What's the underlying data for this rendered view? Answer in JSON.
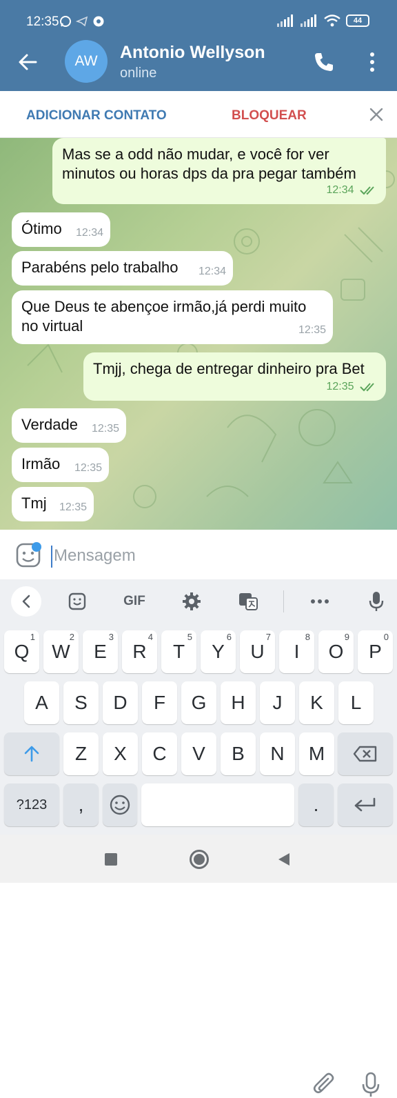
{
  "status_bar": {
    "time": "12:35",
    "battery": "44"
  },
  "header": {
    "avatar_initials": "AW",
    "contact_name": "Antonio Wellyson",
    "status": "online"
  },
  "action_bar": {
    "add_contact": "ADICIONAR CONTATO",
    "block": "BLOQUEAR"
  },
  "messages": [
    {
      "direction": "out",
      "text_line1": "Mas se a odd não mudar, e você for ver",
      "text_line2": "minutos ou horas dps da pra pegar também",
      "time": "12:34"
    },
    {
      "direction": "in",
      "text": "Ótimo",
      "time": "12:34"
    },
    {
      "direction": "in",
      "text": "Parabéns pelo trabalho",
      "time": "12:34"
    },
    {
      "direction": "in",
      "text_line1": "Que Deus te abençoe irmão,já perdi muito",
      "text_line2": "no virtual",
      "time": "12:35"
    },
    {
      "direction": "out",
      "text": "Tmjj, chega de entregar dinheiro pra Bet",
      "time": "12:35"
    },
    {
      "direction": "in",
      "text": "Verdade",
      "time": "12:35"
    },
    {
      "direction": "in",
      "text": "Irmão",
      "time": "12:35"
    },
    {
      "direction": "in",
      "text": "Tmj",
      "time": "12:35"
    }
  ],
  "input": {
    "placeholder": "Mensagem"
  },
  "keyboard": {
    "toolbar": {
      "gif": "GIF"
    },
    "row1": [
      {
        "key": "Q",
        "num": "1"
      },
      {
        "key": "W",
        "num": "2"
      },
      {
        "key": "E",
        "num": "3"
      },
      {
        "key": "R",
        "num": "4"
      },
      {
        "key": "T",
        "num": "5"
      },
      {
        "key": "Y",
        "num": "6"
      },
      {
        "key": "U",
        "num": "7"
      },
      {
        "key": "I",
        "num": "8"
      },
      {
        "key": "O",
        "num": "9"
      },
      {
        "key": "P",
        "num": "0"
      }
    ],
    "row2": [
      "A",
      "S",
      "D",
      "F",
      "G",
      "H",
      "J",
      "K",
      "L"
    ],
    "row3": [
      "Z",
      "X",
      "C",
      "V",
      "B",
      "N",
      "M"
    ],
    "row4": {
      "symbols": "?123",
      "comma": ",",
      "period": "."
    }
  },
  "colors": {
    "header": "#4a7aa5",
    "outgoing_bubble": "#eefcdc",
    "incoming_bubble": "#ffffff",
    "block_red": "#d24f4f",
    "link_blue": "#3f7ab2"
  },
  "icons": [
    "back-arrow-icon",
    "phone-icon",
    "more-vert-icon",
    "close-icon",
    "sticker-icon",
    "paperclip-icon",
    "microphone-icon",
    "settings-icon",
    "translate-icon",
    "emoji-icon",
    "backspace-icon",
    "enter-icon",
    "shift-icon"
  ]
}
